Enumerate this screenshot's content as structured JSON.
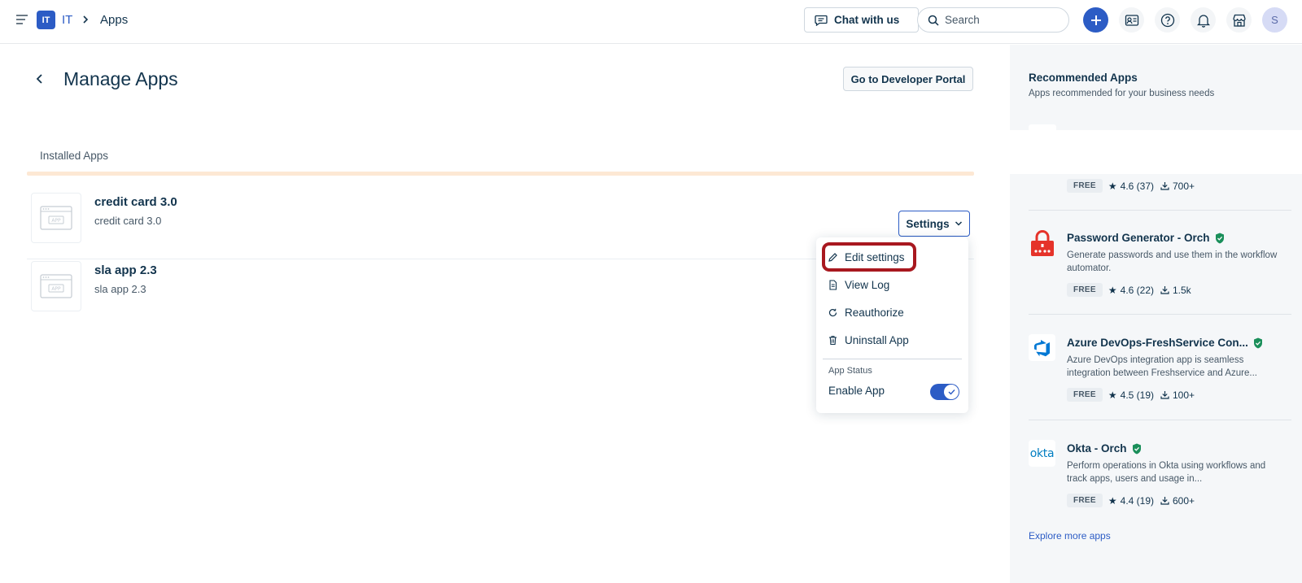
{
  "topbar": {
    "workspace_badge": "IT",
    "workspace_name": "IT",
    "breadcrumb_current": "Apps",
    "chat_label": "Chat with us",
    "search_placeholder": "Search",
    "avatar_initial": "S"
  },
  "main": {
    "title": "Manage Apps",
    "dev_portal_label": "Go to Developer Portal",
    "section_label": "Installed Apps",
    "apps": [
      {
        "name": "credit card 3.0",
        "subtitle": "credit card 3.0"
      },
      {
        "name": "sla app 2.3",
        "subtitle": "sla app 2.3"
      }
    ],
    "settings_label": "Settings",
    "dropdown": {
      "items": [
        "Edit settings",
        "View Log",
        "Reauthorize",
        "Uninstall App"
      ],
      "status_label": "App Status",
      "enable_label": "Enable App",
      "enabled": true
    }
  },
  "sidebar": {
    "title": "Recommended Apps",
    "subtitle": "Apps recommended for your business needs",
    "partial_app": {
      "badge": "FREE",
      "rating": "4.6 (37)",
      "downloads": "700+"
    },
    "apps": [
      {
        "name": "Password Generator - Orch",
        "description": "Generate passwords and use them in the workflow automator.",
        "badge": "FREE",
        "rating": "4.6 (22)",
        "downloads": "1.5k"
      },
      {
        "name": "Azure DevOps-FreshService Con...",
        "description": "Azure DevOps integration app is seamless integration between Freshservice and Azure...",
        "badge": "FREE",
        "rating": "4.5 (19)",
        "downloads": "100+"
      },
      {
        "name": "Okta - Orch",
        "description": "Perform operations in Okta using workflows and track apps, users and usage in...",
        "badge": "FREE",
        "rating": "4.4 (19)",
        "downloads": "600+",
        "logo_text": "okta"
      }
    ],
    "explore_label": "Explore more apps"
  },
  "colors": {
    "primary": "#2c5cc5",
    "text": "#12344d",
    "highlight_ring": "#a8181f",
    "verified": "#1a8f5a"
  }
}
